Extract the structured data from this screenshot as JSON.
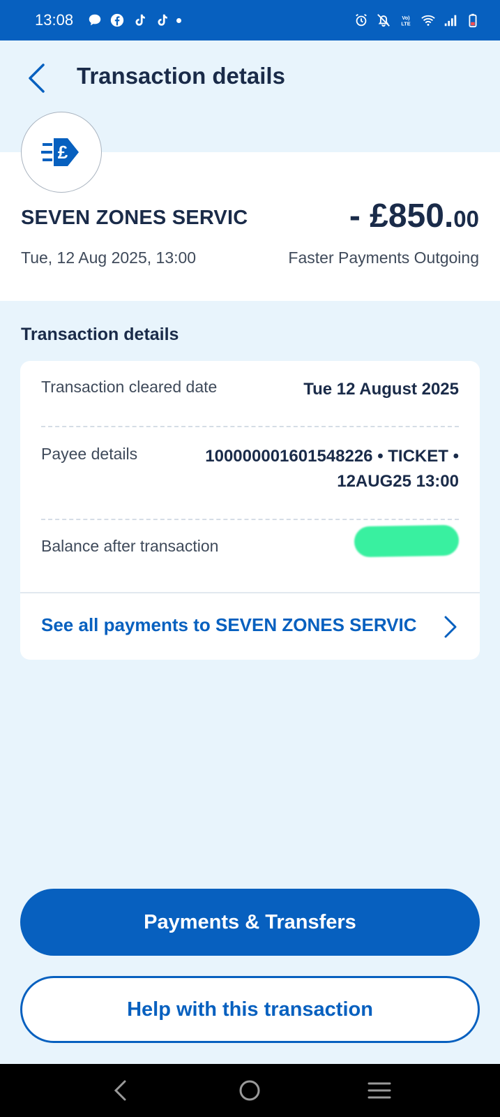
{
  "status_bar": {
    "time": "13:08",
    "left_icons": [
      "chat-bubble-icon",
      "facebook-icon",
      "tiktok-icon",
      "tiktok-icon",
      "dot-icon"
    ],
    "right_icons": [
      "alarm-icon",
      "mute-icon",
      "volte-icon",
      "wifi-icon",
      "signal-icon",
      "battery-icon"
    ],
    "volte_text": "Vo) LTE"
  },
  "header": {
    "title": "Transaction details"
  },
  "summary": {
    "merchant_name": "SEVEN ZONES SERVIC",
    "datetime": "Tue, 12 Aug 2025, 13:00",
    "amount_main": "- £850.",
    "amount_pence": "00",
    "type": "Faster Payments Outgoing"
  },
  "details": {
    "heading": "Transaction details",
    "rows": [
      {
        "label": "Transaction cleared date",
        "value": "Tue 12 August 2025"
      },
      {
        "label": "Payee details",
        "value_line1": "100000001601548226 • TICKET •",
        "value_line2": "12AUG25 13:00"
      },
      {
        "label": "Balance after transaction",
        "value": ""
      }
    ],
    "link": "See all payments to SEVEN ZONES SERVIC"
  },
  "buttons": {
    "primary": "Payments & Transfers",
    "secondary": "Help with this transaction"
  },
  "colors": {
    "brand_blue": "#0760bf",
    "background": "#e8f4fc",
    "text_dark": "#1a2b49",
    "redaction": "#39f0a0"
  }
}
